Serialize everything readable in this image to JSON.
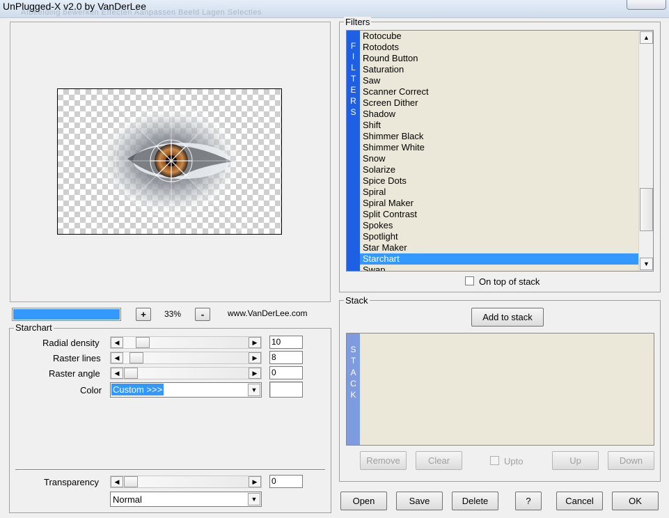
{
  "window": {
    "title": "UnPlugged-X v2.0 by VanDerLee",
    "background_tabs_text": "Afbeelding  bewerken  Effecten  Aanpassen  Beeld  Lagen  Selecties"
  },
  "preview": {
    "zoom": "33%",
    "zoom_in_label": "+",
    "zoom_out_label": "-",
    "website": "www.VanDerLee.com",
    "progress_fraction": 1.0
  },
  "filter_panel": {
    "title": "Starchart",
    "params": [
      {
        "label": "Radial density",
        "value": "10"
      },
      {
        "label": "Raster lines",
        "value": "8"
      },
      {
        "label": "Raster angle",
        "value": "0"
      }
    ],
    "color_label": "Color",
    "color_value": "Custom >>>",
    "transparency_label": "Transparency",
    "transparency_value": "0",
    "blend_mode": "Normal"
  },
  "filters": {
    "group_title": "Filters",
    "band_text": [
      "F",
      "I",
      "L",
      "T",
      "E",
      "R",
      "S"
    ],
    "items": [
      "Rotocube",
      "Rotodots",
      "Round Button",
      "Saturation",
      "Saw",
      "Scanner Correct",
      "Screen Dither",
      "Shadow",
      "Shift",
      "Shimmer Black",
      "Shimmer White",
      "Snow",
      "Solarize",
      "Spice Dots",
      "Spiral",
      "Spiral Maker",
      "Split Contrast",
      "Spokes",
      "Spotlight",
      "Star Maker",
      "Starchart",
      "Swap"
    ],
    "selected": "Starchart",
    "on_top_label": "On top of stack"
  },
  "stack": {
    "group_title": "Stack",
    "band_text": [
      "S",
      "T",
      "A",
      "C",
      "K"
    ],
    "add_label": "Add to stack",
    "remove_label": "Remove",
    "clear_label": "Clear",
    "upto_label": "Upto",
    "up_label": "Up",
    "down_label": "Down"
  },
  "footer": {
    "open": "Open",
    "save": "Save",
    "delete": "Delete",
    "help": "?",
    "cancel": "Cancel",
    "ok": "OK"
  },
  "colors": {
    "filters_band": "#1f5fe4",
    "stack_band": "#7f9be0",
    "selection": "#3399ff",
    "list_background": "#ebe8da"
  }
}
